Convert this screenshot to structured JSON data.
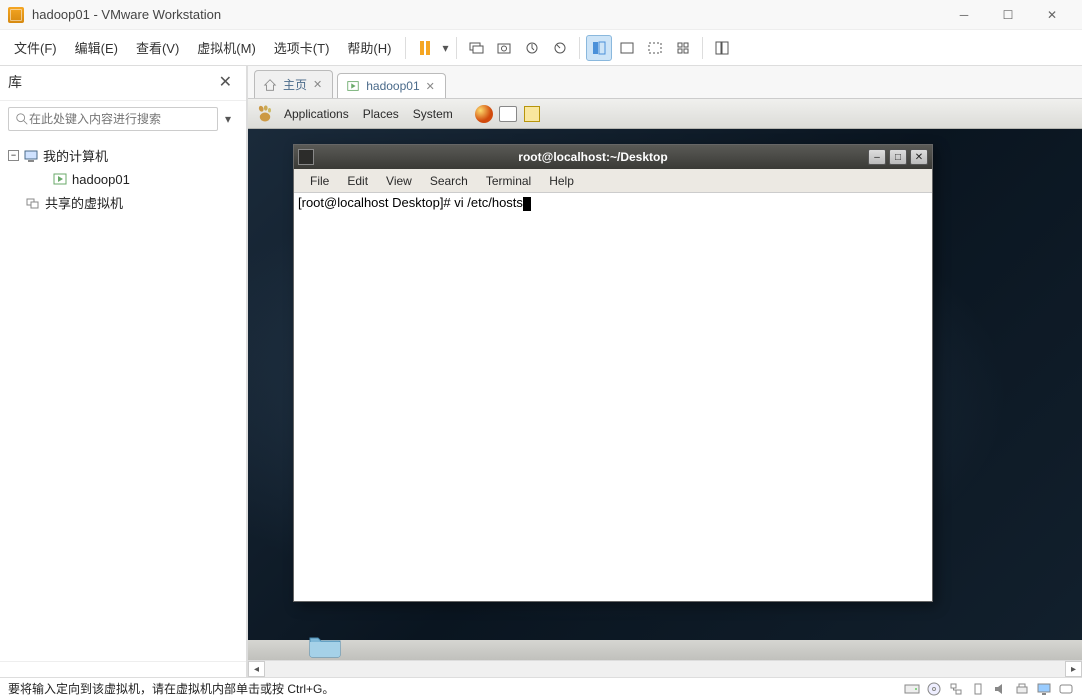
{
  "window": {
    "title": "hadoop01 - VMware Workstation"
  },
  "menu": {
    "file": "文件(F)",
    "edit": "编辑(E)",
    "view": "查看(V)",
    "vm": "虚拟机(M)",
    "tabs": "选项卡(T)",
    "help": "帮助(H)"
  },
  "sidebar": {
    "title": "库",
    "search_placeholder": "在此处键入内容进行搜索",
    "nodes": {
      "my_computer": "我的计算机",
      "hadoop01": "hadoop01",
      "shared": "共享的虚拟机"
    }
  },
  "tabs": {
    "home": "主页",
    "vm": "hadoop01"
  },
  "guest_panel": {
    "apps": "Applications",
    "places": "Places",
    "system": "System"
  },
  "terminal": {
    "title": "root@localhost:~/Desktop",
    "menus": {
      "file": "File",
      "edit": "Edit",
      "view": "View",
      "search": "Search",
      "terminal": "Terminal",
      "help": "Help"
    },
    "line": "[root@localhost Desktop]# vi /etc/hosts"
  },
  "statusbar": {
    "text": "要将输入定向到该虚拟机，请在虚拟机内部单击或按 Ctrl+G。"
  }
}
